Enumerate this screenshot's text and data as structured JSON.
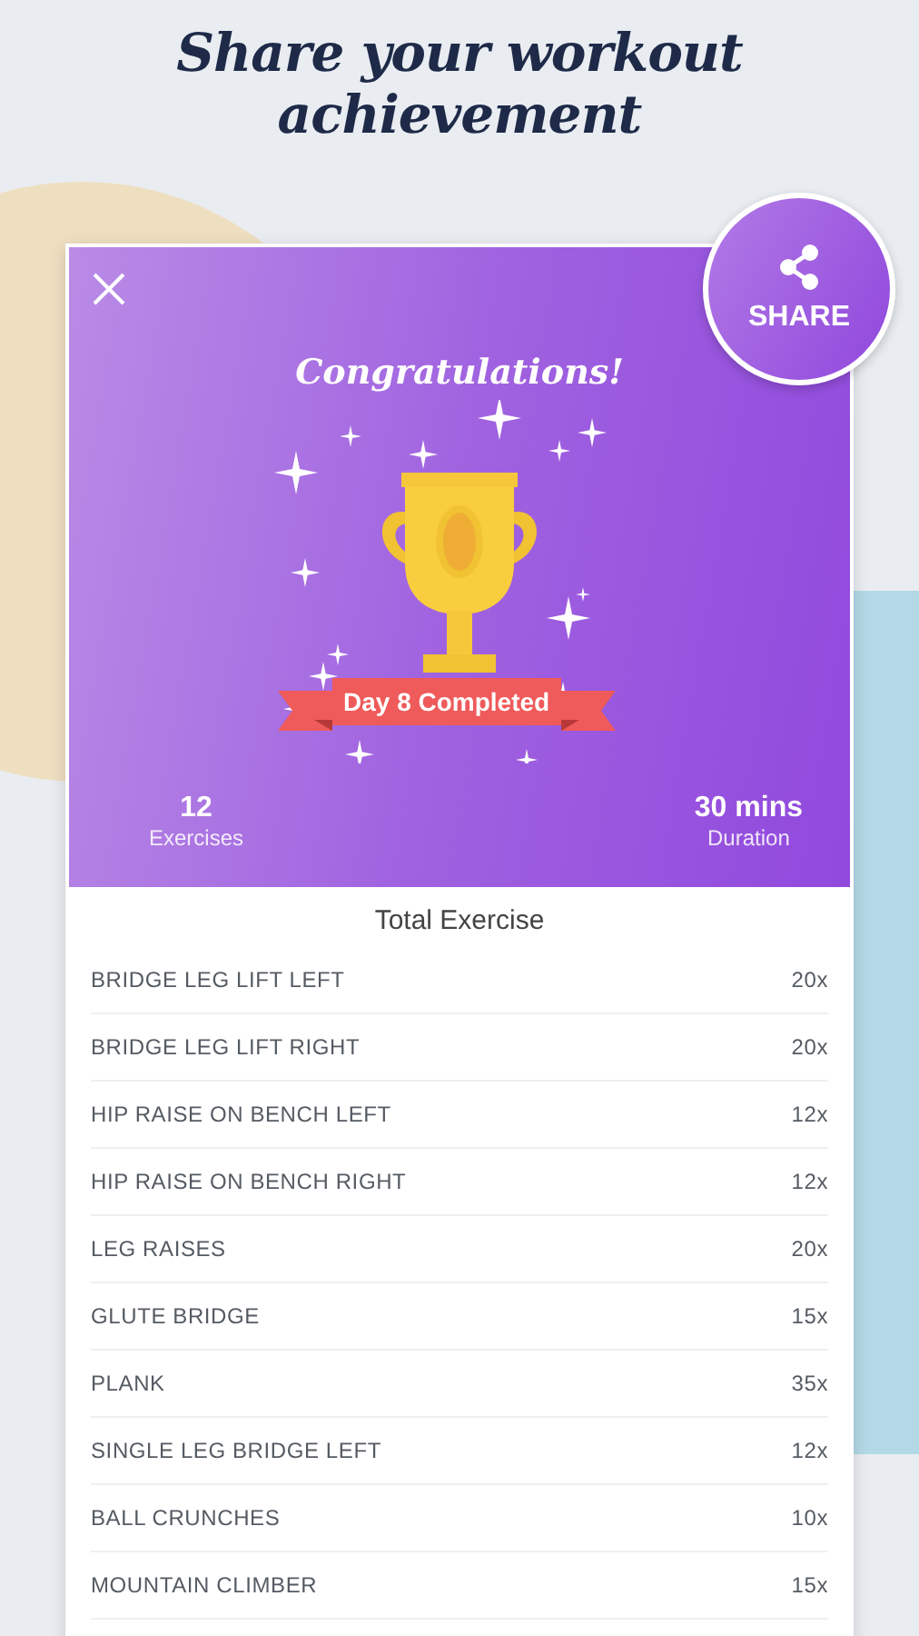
{
  "headline": "Share your workout achievement",
  "card": {
    "title": "Congratulations!",
    "banner": "Day 8 Completed",
    "stats": [
      {
        "value": "12",
        "label": "Exercises"
      },
      {
        "value": "30 mins",
        "label": "Duration"
      }
    ],
    "share_button": {
      "label": "SHARE"
    },
    "list_title": "Total Exercise",
    "exercises": [
      {
        "name": "BRIDGE LEG LIFT LEFT",
        "reps": "20x"
      },
      {
        "name": "BRIDGE LEG LIFT RIGHT",
        "reps": "20x"
      },
      {
        "name": "HIP RAISE ON BENCH LEFT",
        "reps": "12x"
      },
      {
        "name": "HIP RAISE ON BENCH RIGHT",
        "reps": "12x"
      },
      {
        "name": "LEG RAISES",
        "reps": "20x"
      },
      {
        "name": "GLUTE BRIDGE",
        "reps": "15x"
      },
      {
        "name": "PLANK",
        "reps": "35x"
      },
      {
        "name": "SINGLE LEG BRIDGE LEFT",
        "reps": "12x"
      },
      {
        "name": "BALL CRUNCHES",
        "reps": "10x"
      },
      {
        "name": "MOUNTAIN CLIMBER",
        "reps": "15x"
      }
    ]
  }
}
